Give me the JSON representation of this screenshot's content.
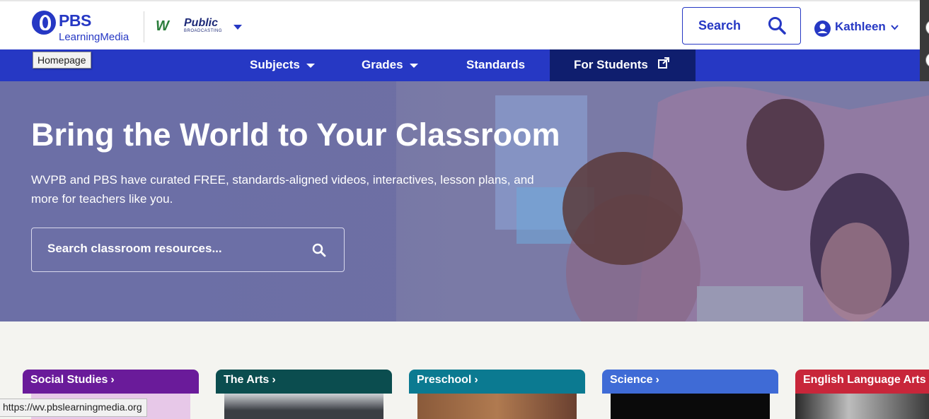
{
  "header": {
    "logo": {
      "brand": "PBS",
      "product": "LearningMedia"
    },
    "station": {
      "mark": "W",
      "name": "Public",
      "sub": "BROADCASTING"
    },
    "search_label": "Search",
    "user_name": "Kathleen"
  },
  "tooltip": "Homepage",
  "nav": {
    "items": [
      {
        "label": "Subjects"
      },
      {
        "label": "Grades"
      },
      {
        "label": "Standards"
      },
      {
        "label": "For Students"
      }
    ]
  },
  "hero": {
    "title": "Bring the World to Your Classroom",
    "subtitle": "WVPB and PBS have curated FREE, standards-aligned videos, interactives, lesson plans, and more for teachers like you.",
    "search_placeholder": "Search classroom resources..."
  },
  "cards": [
    {
      "label": "Social Studies",
      "color": "#6a1b9a"
    },
    {
      "label": "The Arts",
      "color": "#0b4d4f"
    },
    {
      "label": "Preschool",
      "color": "#0b7a91"
    },
    {
      "label": "Science",
      "color": "#3f6bd6"
    },
    {
      "label": "English Language Arts",
      "color": "#c8263a"
    }
  ],
  "status_bar": "https://wv.pbslearningmedia.org",
  "colors": {
    "brand": "#2638c4",
    "nav_active": "#0f1e6e"
  }
}
